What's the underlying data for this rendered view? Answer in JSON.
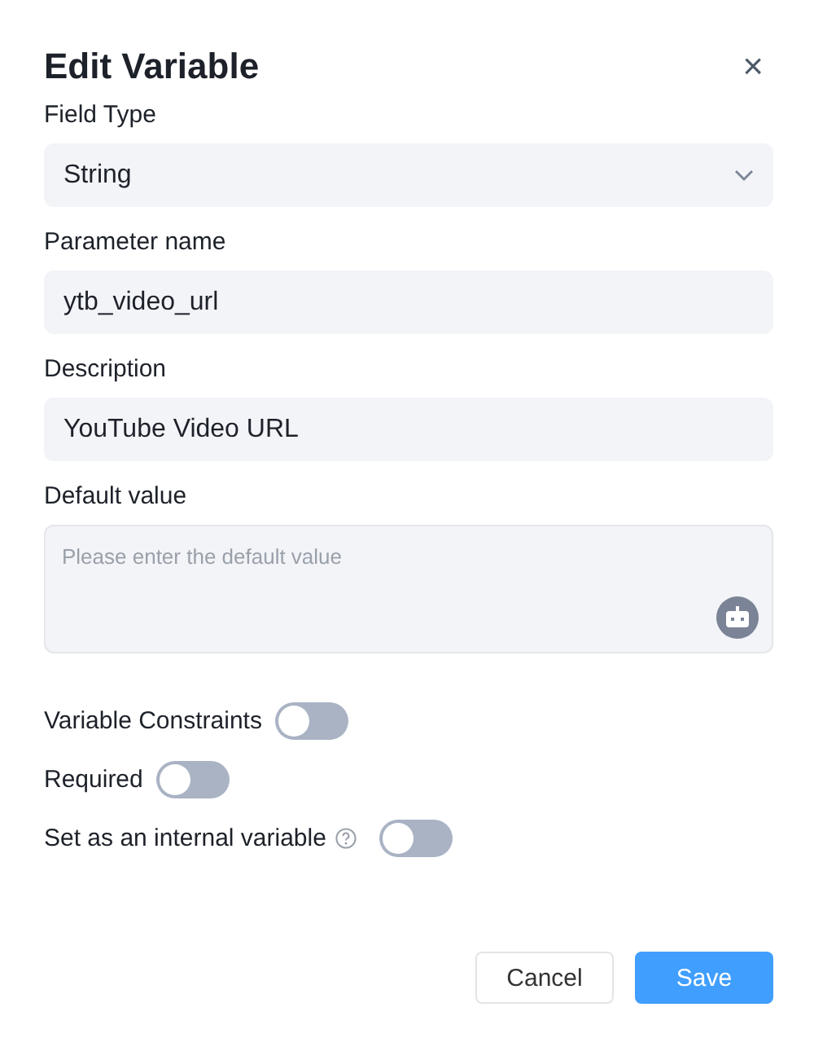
{
  "dialog": {
    "title": "Edit Variable",
    "close": "×"
  },
  "fields": [
    {
      "kind": "select",
      "label": "Field Type",
      "value": "String"
    },
    {
      "kind": "text",
      "label": "Parameter name",
      "value": "ytb_video_url"
    },
    {
      "kind": "text",
      "label": "Description",
      "value": "YouTube Video URL"
    },
    {
      "kind": "textarea",
      "label": "Default value",
      "placeholder": "Please enter the default value"
    }
  ],
  "toggles": [
    {
      "label": "Variable Constraints",
      "on": false,
      "help": false
    },
    {
      "label": "Required",
      "on": false,
      "help": false
    },
    {
      "label": "Set as an internal variable",
      "on": false,
      "help": true
    }
  ],
  "buttons": [
    {
      "kind": "secondary",
      "label": "Cancel"
    },
    {
      "kind": "primary",
      "label": "Save"
    }
  ]
}
